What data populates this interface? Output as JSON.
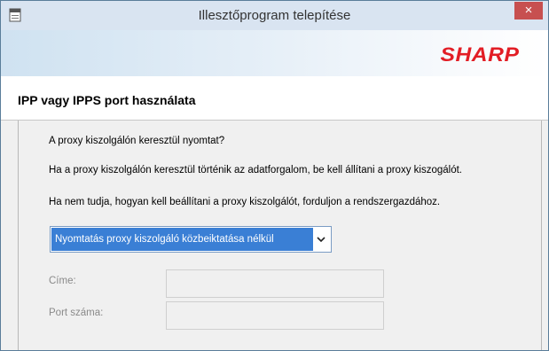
{
  "window": {
    "title": "Illesztőprogram telepítése",
    "close_label": "×"
  },
  "brand": {
    "logo": "SHARP",
    "logo_color": "#e21d25"
  },
  "page": {
    "title": "IPP vagy IPPS port használata"
  },
  "content": {
    "question": "A proxy kiszolgálón keresztül nyomtat?",
    "info1": "Ha a proxy kiszolgálón keresztül történik az adatforgalom, be kell állítani a proxy kiszogálót.",
    "info2": "Ha nem tudja, hogyan kell beállítani a proxy kiszolgálót, forduljon a rendszergazdához."
  },
  "proxy_select": {
    "selected": "Nyomtatás proxy kiszolgáló közbeiktatása nélkül"
  },
  "fields": {
    "address_label": "Címe:",
    "port_label": "Port száma:",
    "address_value": "",
    "port_value": ""
  },
  "icons": {
    "app": "window-app-icon",
    "close": "close-icon",
    "dropdown": "chevron-down-icon"
  },
  "colors": {
    "selection": "#3a7fd5",
    "close_button": "#c75050"
  }
}
